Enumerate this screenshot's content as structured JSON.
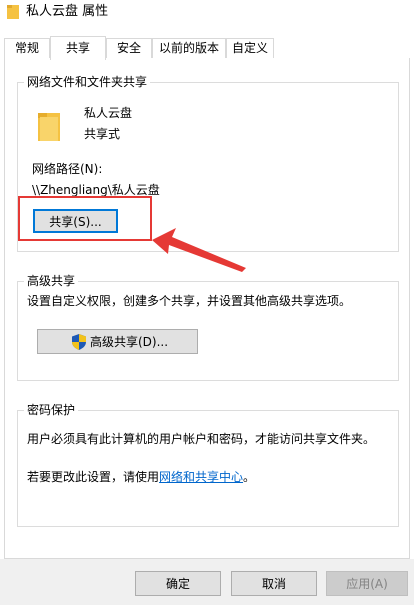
{
  "window": {
    "title": "私人云盘 属性"
  },
  "tabs": [
    {
      "label": "常规",
      "active": false
    },
    {
      "label": "共享",
      "active": true
    },
    {
      "label": "安全",
      "active": false
    },
    {
      "label": "以前的版本",
      "active": false
    },
    {
      "label": "自定义",
      "active": false
    }
  ],
  "network_share": {
    "group_title": "网络文件和文件夹共享",
    "folder_name": "私人云盘",
    "share_status": "共享式",
    "path_label": "网络路径(N):",
    "path_value": "\\\\Zhengliang\\私人云盘",
    "share_button": "共享(S)..."
  },
  "advanced_share": {
    "group_title": "高级共享",
    "description": "设置自定义权限，创建多个共享，并设置其他高级共享选项。",
    "button": "高级共享(D)..."
  },
  "password_protection": {
    "group_title": "密码保护",
    "description": "用户必须具有此计算机的用户帐户和密码，才能访问共享文件夹。",
    "change_prefix": "若要更改此设置，请使用",
    "change_link": "网络和共享中心",
    "change_suffix": "。"
  },
  "footer": {
    "ok": "确定",
    "cancel": "取消",
    "apply": "应用(A)"
  },
  "colors": {
    "accent": "#0078d7",
    "annotation": "#e53935",
    "folder": "#f5c242",
    "link": "#0066cc"
  }
}
